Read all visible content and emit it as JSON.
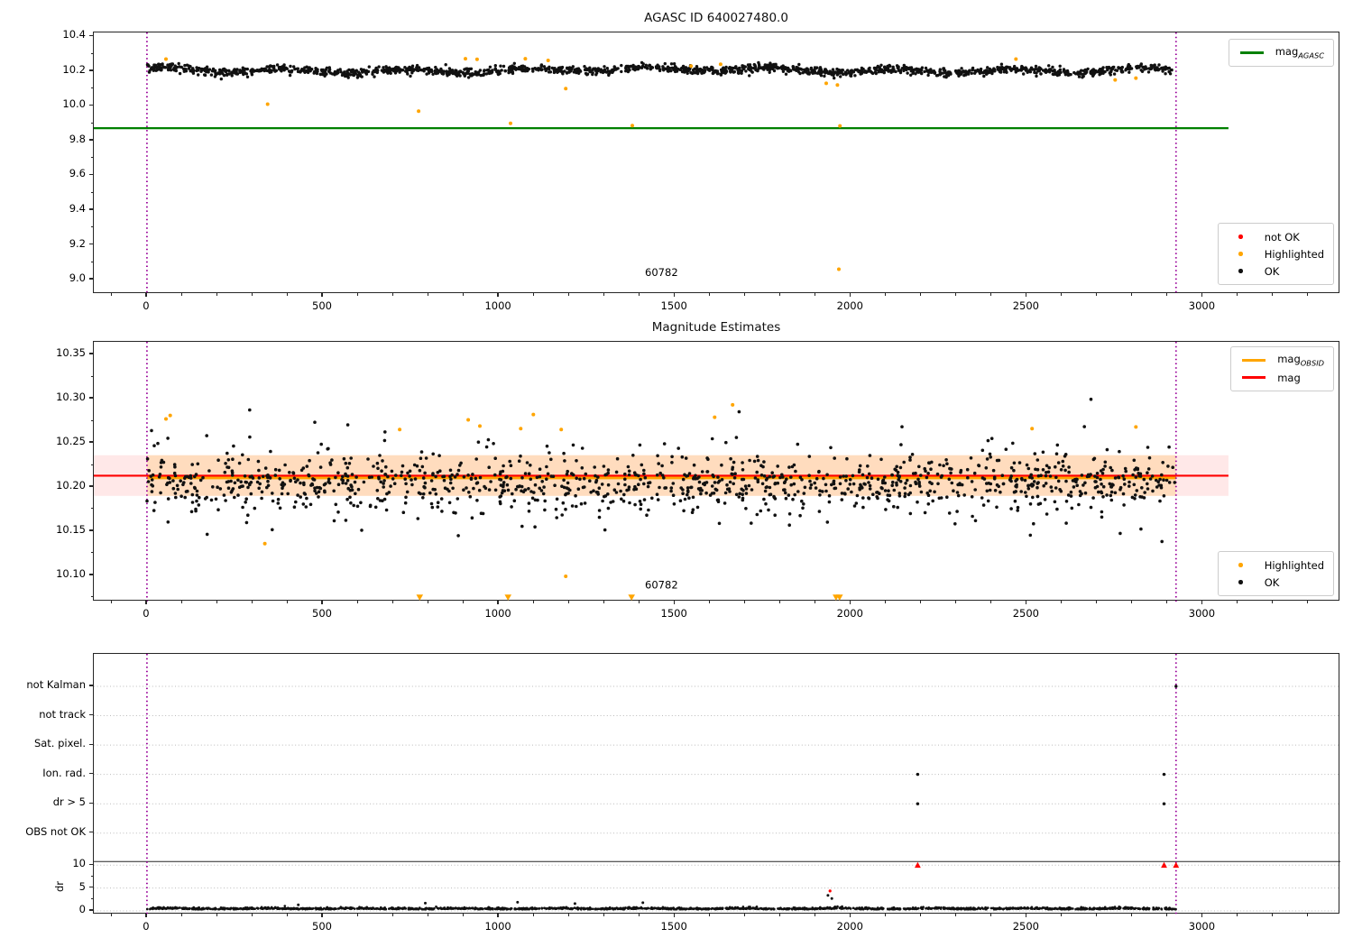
{
  "colors": {
    "ok": "#111111",
    "highlighted": "#ffa500",
    "not_ok": "#ff0000",
    "mag_agasc_line": "#008000",
    "mag_line": "#ff0000",
    "mag_obsid_line": "#ffa500",
    "obsid_boundary": "#990099",
    "mag_band_fill": "rgba(255,0,0,0.09)",
    "obsid_band_fill": "rgba(255,165,0,0.18)",
    "gridline": "#bbbbbb"
  },
  "chart_data": [
    {
      "type": "scatter",
      "title": "AGASC ID 640027480.0",
      "xlim": [
        -151,
        3391
      ],
      "ylim": [
        8.917,
        10.423
      ],
      "xticks": [
        0,
        500,
        1000,
        1500,
        2000,
        2500,
        3000
      ],
      "yticks": [
        9.0,
        9.2,
        9.4,
        9.6,
        9.8,
        10.0,
        10.2,
        10.4
      ],
      "ytick_labels": [
        "9.0",
        "9.2",
        "9.4",
        "9.6",
        "9.8",
        "10.0",
        "10.2",
        "10.4"
      ],
      "obsid_span": [
        0,
        2924
      ],
      "mag_agasc": 9.872,
      "line_span": [
        -151,
        3073
      ],
      "legend_line": [
        {
          "label": "mag",
          "sub": "AGASC",
          "color": "#008000",
          "marker": "line"
        }
      ],
      "legend_points": [
        {
          "label": "not OK",
          "color": "#ff0000",
          "marker": "dot"
        },
        {
          "label": "Highlighted",
          "color": "#ffa500",
          "marker": "dot"
        },
        {
          "label": "OK",
          "color": "#111111",
          "marker": "dot"
        }
      ],
      "annotation": {
        "text": "60782",
        "x": 1462,
        "y": 9.02
      },
      "ok_scatter": {
        "n": 1700,
        "x_range": [
          0,
          2924
        ],
        "mean": 10.206,
        "noise_sd": 0.012,
        "y_clip": [
          10.14,
          10.3
        ],
        "seed": 7
      },
      "highlighted_points": [
        [
          54,
          10.27
        ],
        [
          343,
          10.01
        ],
        [
          772,
          9.97
        ],
        [
          905,
          10.272
        ],
        [
          938,
          10.268
        ],
        [
          1033,
          9.9
        ],
        [
          1075,
          10.272
        ],
        [
          1140,
          10.262
        ],
        [
          1190,
          10.1
        ],
        [
          1379,
          9.887
        ],
        [
          1546,
          10.23
        ],
        [
          1630,
          10.24
        ],
        [
          1930,
          10.13
        ],
        [
          1962,
          10.12
        ],
        [
          1966,
          9.06
        ],
        [
          1969,
          9.885
        ],
        [
          2469,
          10.27
        ],
        [
          2751,
          10.15
        ],
        [
          2810,
          10.16
        ]
      ]
    },
    {
      "type": "scatter",
      "title": "Magnitude Estimates",
      "xlim": [
        -151,
        3391
      ],
      "ylim": [
        10.0704,
        10.3643
      ],
      "xticks": [
        0,
        500,
        1000,
        1500,
        2000,
        2500,
        3000
      ],
      "yticks": [
        10.1,
        10.15,
        10.2,
        10.25,
        10.3,
        10.35
      ],
      "ytick_labels": [
        "10.10",
        "10.15",
        "10.20",
        "10.25",
        "10.30",
        "10.35"
      ],
      "obsid_span": [
        0,
        2924
      ],
      "mag": 10.2128,
      "mag_band": [
        10.19,
        10.236
      ],
      "mag_obsid": 10.2115,
      "line_span": [
        -151,
        3073
      ],
      "legend_line": [
        {
          "label": "mag",
          "sub": "OBSID",
          "color": "#ffa500",
          "marker": "line"
        },
        {
          "label": "mag",
          "color": "#ff0000",
          "marker": "line"
        }
      ],
      "legend_points": [
        {
          "label": "Highlighted",
          "color": "#ffa500",
          "marker": "dot"
        },
        {
          "label": "OK",
          "color": "#111111",
          "marker": "dot"
        }
      ],
      "annotation": {
        "text": "60782",
        "x": 1462,
        "y": 10.085
      },
      "ok_scatter": {
        "n": 1250,
        "x_range": [
          0,
          2924
        ],
        "mean": 10.208,
        "noise_sd": 0.014,
        "y_clip": [
          10.135,
          10.302
        ],
        "seed": 11
      },
      "highlighted_points": [
        [
          54,
          10.277
        ],
        [
          66,
          10.281
        ],
        [
          335,
          10.136
        ],
        [
          718,
          10.265
        ],
        [
          913,
          10.276
        ],
        [
          946,
          10.269
        ],
        [
          1062,
          10.266
        ],
        [
          1098,
          10.282
        ],
        [
          1177,
          10.265
        ],
        [
          1190,
          10.099
        ],
        [
          1613,
          10.279
        ],
        [
          1664,
          10.293
        ],
        [
          2515,
          10.266
        ],
        [
          2810,
          10.268
        ]
      ],
      "clipped_low_x": [
        775,
        1026,
        1377,
        1958,
        1968
      ]
    },
    {
      "type": "scatter-flags",
      "flags": [
        "not Kalman",
        "not track",
        "Sat. pixel.",
        "Ion. rad.",
        "dr > 5",
        "OBS not OK"
      ],
      "xlim": [
        -151,
        3391
      ],
      "xticks": [
        0,
        500,
        1000,
        1500,
        2000,
        2500,
        3000
      ],
      "dr_label": "dr",
      "dr_ticks": [
        0,
        5,
        10
      ],
      "obsid_span": [
        0,
        2924
      ],
      "dr_scatter": {
        "n": 1800,
        "x_range": [
          0,
          2924
        ],
        "mean": 0.5,
        "noise_sd": 0.16,
        "y_clip": [
          0.06,
          1.25
        ],
        "seed": 23
      },
      "dr_spikes": [
        [
          430,
          1.35
        ],
        [
          791,
          1.7
        ],
        [
          1053,
          1.9
        ],
        [
          1216,
          1.6
        ],
        [
          1409,
          1.8
        ],
        [
          1935,
          3.4
        ],
        [
          1946,
          2.7
        ]
      ],
      "dr_not_ok": [
        [
          1941,
          4.35
        ]
      ],
      "dr_clipped_x": [
        2190,
        2890,
        2924
      ],
      "flag_events": [
        {
          "label": "Ion. rad.",
          "x": 2190
        },
        {
          "label": "Ion. rad.",
          "x": 2890
        },
        {
          "label": "dr > 5",
          "x": 2190
        },
        {
          "label": "dr > 5",
          "x": 2890
        },
        {
          "label": "not Kalman",
          "x": 2924
        }
      ]
    }
  ]
}
